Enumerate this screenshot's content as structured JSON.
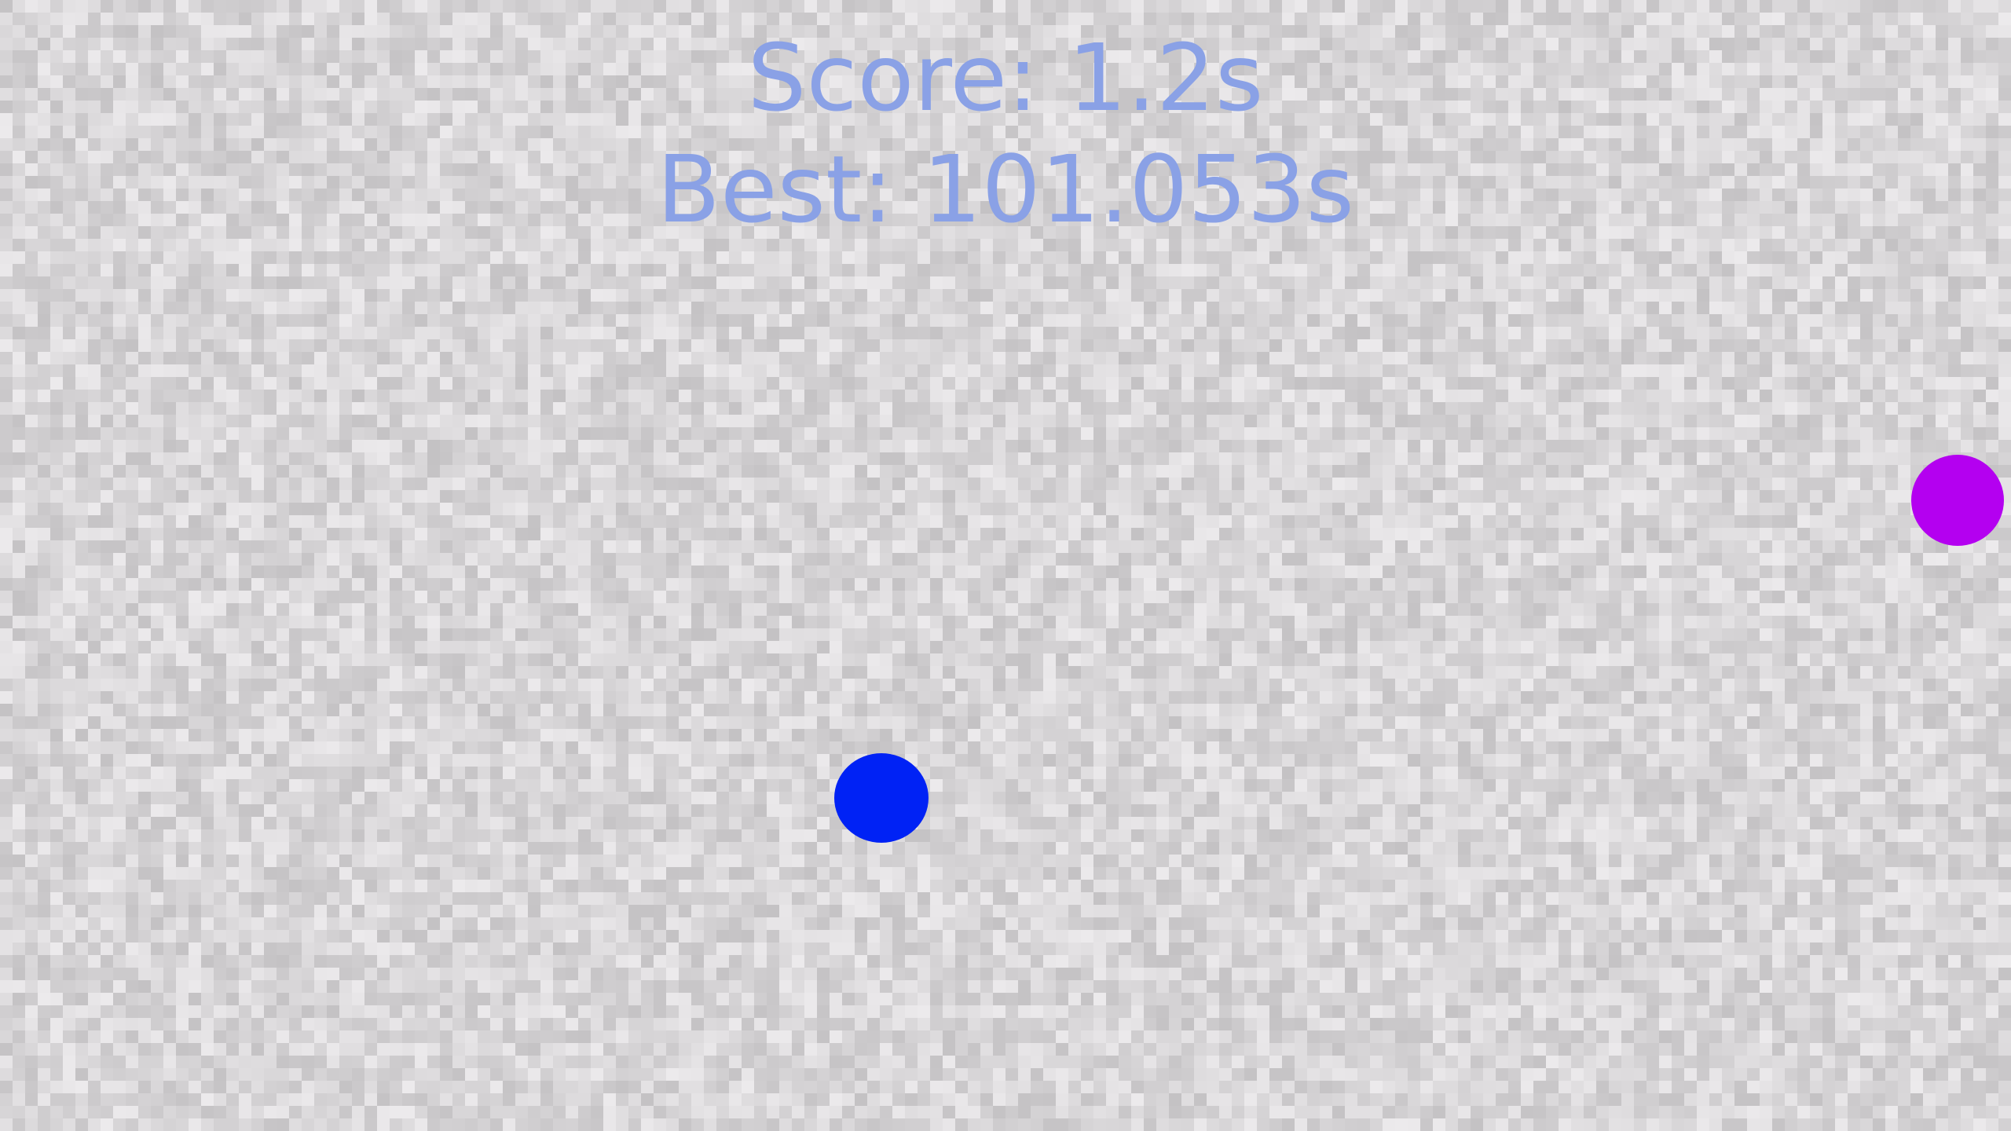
{
  "hud": {
    "score_label": "Score: 1.2s",
    "best_label": "Best: 101.053s",
    "text_color": "#8aa1e6"
  },
  "player": {
    "color": "#0022f5"
  },
  "enemy": {
    "color": "#b400f0"
  },
  "background": {
    "base_color": "#d6d4d6",
    "light_color": "#eceaec",
    "dark_color": "#c4c2c4"
  }
}
